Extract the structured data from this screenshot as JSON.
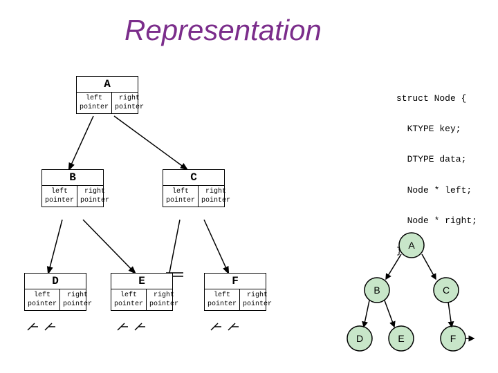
{
  "title": "Representation",
  "nodes": {
    "A": {
      "label": "A",
      "left": "left",
      "right": "right",
      "left2": "pointer",
      "right2": "pointer"
    },
    "B": {
      "label": "B",
      "left": "left",
      "right": "right",
      "left2": "pointer",
      "right2": "pointer"
    },
    "C": {
      "label": "C",
      "left": "left",
      "right": "right",
      "left2": "pointer",
      "right2": "pointer"
    },
    "D": {
      "label": "D",
      "left": "left",
      "right": "right",
      "left2": "pointer",
      "right2": "pointer"
    },
    "E": {
      "label": "E",
      "left": "left",
      "right": "right",
      "left2": "pointer",
      "right2": "pointer"
    },
    "F": {
      "label": "F",
      "left": "left",
      "right": "right",
      "left2": "pointer",
      "right2": "pointer"
    }
  },
  "struct_code": {
    "line1": "struct Node {",
    "line2": "  KTYPE key;",
    "line3": "  DTYPE data;",
    "line4": "  Node * left;",
    "line5": "  Node * right;",
    "line6": "};"
  },
  "small_tree": {
    "nodes": [
      "A",
      "B",
      "C",
      "D",
      "E",
      "F"
    ]
  }
}
